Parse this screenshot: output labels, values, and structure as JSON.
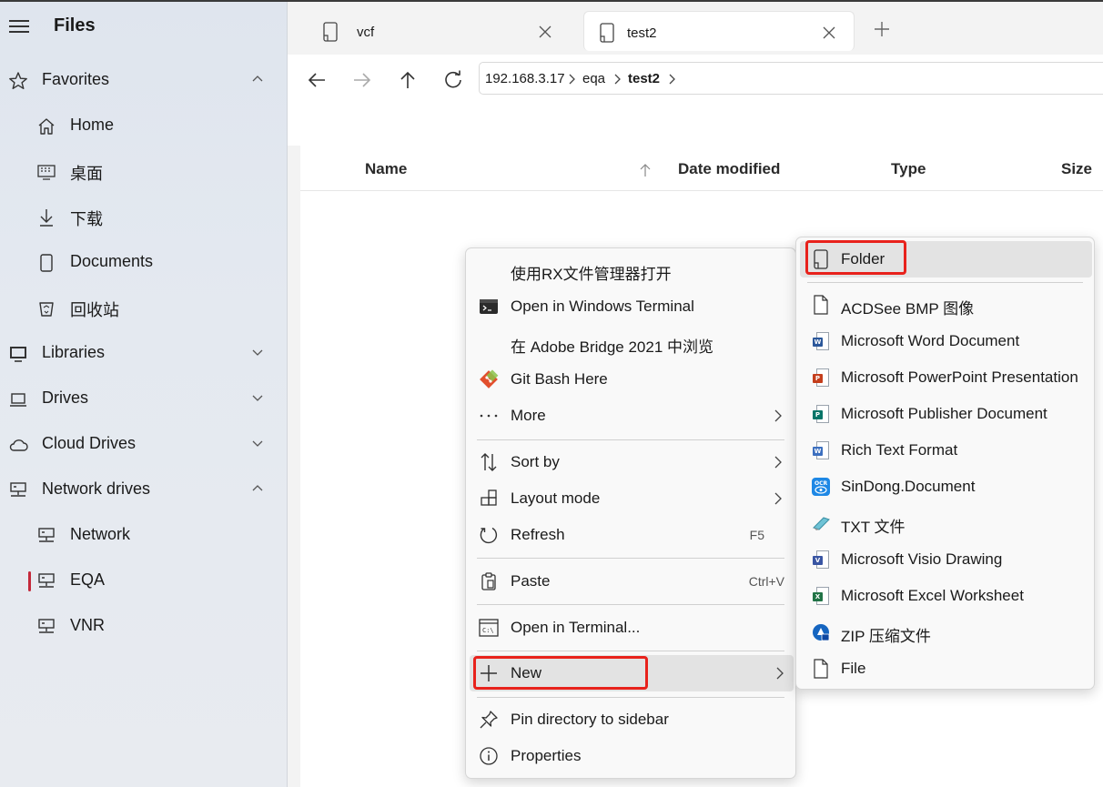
{
  "app": {
    "title": "Files"
  },
  "sidebar": {
    "favorites": {
      "label": "Favorites",
      "icon": "star-icon",
      "expanded": true
    },
    "favorites_items": [
      {
        "label": "Home",
        "icon": "home-icon"
      },
      {
        "label": "桌面",
        "icon": "desktop-icon"
      },
      {
        "label": "下载",
        "icon": "download-icon"
      },
      {
        "label": "Documents",
        "icon": "document-icon"
      },
      {
        "label": "回收站",
        "icon": "recycle-bin-icon"
      }
    ],
    "libraries": {
      "label": "Libraries"
    },
    "drives": {
      "label": "Drives"
    },
    "cloud_drives": {
      "label": "Cloud Drives"
    },
    "network_drives": {
      "label": "Network drives",
      "expanded": true
    },
    "network_items": [
      {
        "label": "Network",
        "selected": false
      },
      {
        "label": "EQA",
        "selected": true
      },
      {
        "label": "VNR",
        "selected": false
      }
    ],
    "selected_color": "#c4283a"
  },
  "tabs": [
    {
      "label": "vcf",
      "active": false
    },
    {
      "label": "test2",
      "active": true
    }
  ],
  "breadcrumb": [
    "192.168.3.17",
    "eqa",
    "test2"
  ],
  "columns": {
    "name": "Name",
    "date_modified": "Date modified",
    "type": "Type",
    "size": "Size"
  },
  "context_menu": {
    "open_rx": "使用RX文件管理器打开",
    "open_windows_terminal": "Open in Windows Terminal",
    "adobe_bridge": "在 Adobe Bridge 2021 中浏览",
    "git_bash": "Git Bash Here",
    "more": "More",
    "sort_by": "Sort by",
    "layout_mode": "Layout mode",
    "refresh": "Refresh",
    "refresh_key": "F5",
    "paste": "Paste",
    "paste_key": "Ctrl+V",
    "open_terminal": "Open in Terminal...",
    "new": "New",
    "pin_sidebar": "Pin directory to sidebar",
    "properties": "Properties"
  },
  "new_submenu": [
    {
      "label": "Folder",
      "icon": "folder-icon"
    },
    {
      "label": "ACDSee BMP 图像",
      "icon": "blank-file-icon"
    },
    {
      "label": "Microsoft Word Document",
      "icon": "word-icon"
    },
    {
      "label": "Microsoft PowerPoint Presentation",
      "icon": "powerpoint-icon"
    },
    {
      "label": "Microsoft Publisher Document",
      "icon": "publisher-icon"
    },
    {
      "label": "Rich Text Format",
      "icon": "wordpad-icon"
    },
    {
      "label": "SinDong.Document",
      "icon": "ocr-icon"
    },
    {
      "label": "TXT 文件",
      "icon": "text-file-icon"
    },
    {
      "label": "Microsoft Visio Drawing",
      "icon": "visio-icon"
    },
    {
      "label": "Microsoft Excel Worksheet",
      "icon": "excel-icon"
    },
    {
      "label": "ZIP 压缩文件",
      "icon": "zip-icon"
    },
    {
      "label": "File",
      "icon": "blank-file-icon"
    }
  ],
  "colors": {
    "highlight_box": "#e8221c",
    "word": "#2b579a",
    "powerpoint": "#c43e1c",
    "publisher": "#077568",
    "visio": "#3955a3",
    "excel": "#217346"
  }
}
